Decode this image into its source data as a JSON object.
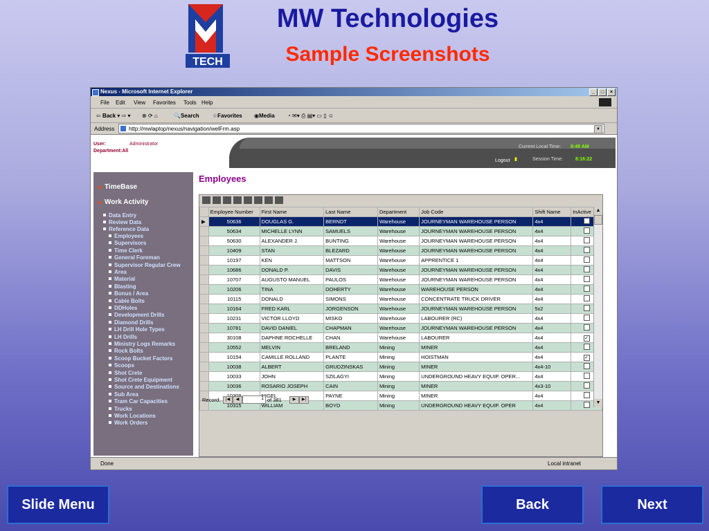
{
  "slide": {
    "logo_text": "TECH",
    "title": "MW Technologies",
    "subtitle": "Sample Screenshots",
    "buttons": {
      "menu": "Slide Menu",
      "back": "Back",
      "next": "Next"
    }
  },
  "browser": {
    "title": "Nexus - Microsoft Internet Explorer",
    "menu": [
      "File",
      "Edit",
      "View",
      "Favorites",
      "Tools",
      "Help"
    ],
    "toolbar": [
      "Back",
      "Search",
      "Favorites",
      "Media"
    ],
    "address_label": "Address",
    "address": "http://mwlaptop/nexus/navigation/welFrm.asp",
    "status": "Done",
    "zone": "Local intranet"
  },
  "app": {
    "user_label": "User:",
    "user": "Administrator",
    "department_label": "Department:All",
    "local_time_label": "Current Local Time:",
    "local_time": "9:49 AM",
    "logout": "Logout",
    "session_label": "Session Time:",
    "session_time": "8:16:22"
  },
  "sidebar": {
    "main": [
      "TimeBase",
      "Work Activity"
    ],
    "sub": [
      "Data Entry",
      "Review Data",
      "Reference Data"
    ],
    "ref_items": [
      "Employees",
      "Supervisors",
      "Time Clerk",
      "General Foreman",
      "Supervisor Regular Crew",
      "Area",
      "Material",
      "Blasting",
      "Bonus / Area",
      "Cable Bolts",
      "DDHoles",
      "Development Drills",
      "Diamond Drills",
      "LH Drill Hole Types",
      "LH Drills",
      "Ministry Logs Remarks",
      "Rock Bolts",
      "Scoop Bucket Factors",
      "Scoops",
      "Shot Crete",
      "Shot Crete Equipment",
      "Source and Destinations",
      "Sub Area",
      "Tram Car Capacities",
      "Trucks",
      "Work Locations",
      "Work Orders"
    ]
  },
  "employees": {
    "title": "Employees",
    "columns": [
      "Employee Number",
      "First Name",
      "Last Name",
      "Department",
      "Job Code",
      "Shift Name",
      "InActive"
    ],
    "rows": [
      [
        "50636",
        "DOUGLAS G.",
        "BERNDT",
        "Warehouse",
        "JOURNEYMAN WAREHOUSE PERSON",
        "4x4",
        false
      ],
      [
        "50634",
        "MICHELLE LYNN",
        "SAMUELS",
        "Warehouse",
        "JOURNEYMAN WAREHOUSE PERSON",
        "4x4",
        false
      ],
      [
        "50630",
        "ALEXANDER J.",
        "BUNTING",
        "Warehouse",
        "JOURNEYMAN WAREHOUSE PERSON",
        "4x4",
        false
      ],
      [
        "10409",
        "STAN",
        "BLEZARD",
        "Warehouse",
        "JOURNEYMAN WAREHOUSE PERSON",
        "4x4",
        false
      ],
      [
        "10197",
        "KEN",
        "MATTSON",
        "Warehouse",
        "APPRENTICE 1",
        "4x4",
        false
      ],
      [
        "10686",
        "DONALD P.",
        "DAVIS",
        "Warehouse",
        "JOURNEYMAN WAREHOUSE PERSON",
        "4x4",
        false
      ],
      [
        "10707",
        "AUGUSTO MANUEL",
        "PAULOS",
        "Warehouse",
        "JOURNEYMAN WAREHOUSE PERSON",
        "4x4",
        false
      ],
      [
        "10206",
        "TINA",
        "DOHERTY",
        "Warehouse",
        "WAREHOUSE PERSON",
        "4x4",
        false
      ],
      [
        "10115",
        "DONALD",
        "SIMONS",
        "Warehouse",
        "CONCENTRATE TRUCK DRIVER",
        "4x4",
        false
      ],
      [
        "10164",
        "FRED KARL",
        "JORGENSON",
        "Warehouse",
        "JOURNEYMAN WAREHOUSE PERSON",
        "5x2",
        false
      ],
      [
        "10231",
        "VICTOR LLOYD",
        "MISKO",
        "Warehouse",
        "LABOURER (RC)",
        "4x4",
        false
      ],
      [
        "10781",
        "DAVID DANIEL",
        "CHAPMAN",
        "Warehouse",
        "JOURNEYMAN WAREHOUSE PERSON",
        "4x4",
        false
      ],
      [
        "30108",
        "DAPHNE ROCHELLE",
        "CHAN",
        "Warehouse",
        "LABOURER",
        "4x4",
        true
      ],
      [
        "10552",
        "MELVIN",
        "BRELAND",
        "Mining",
        "MINER",
        "4x4",
        false
      ],
      [
        "10154",
        "CAMILLE ROLLAND",
        "PLANTE",
        "Mining",
        "HOISTMAN",
        "4x4",
        true
      ],
      [
        "10038",
        "ALBERT",
        "GRUDZINSKAS",
        "Mining",
        "MINER",
        "4x4-10",
        false
      ],
      [
        "10033",
        "JOHN",
        "SZILAGYI",
        "Mining",
        "UNDERGROUND HEAVY EQUIP. OPER...",
        "4x4",
        false
      ],
      [
        "10036",
        "ROSARIO JOSEPH",
        "CAIN",
        "Mining",
        "MINER",
        "4x3-10",
        false
      ],
      [
        "10309",
        "NIGEL",
        "PAYNE",
        "Mining",
        "MINER",
        "4x4",
        false
      ],
      [
        "10315",
        "WILLIAM",
        "BOYD",
        "Mining",
        "UNDERGROUND HEAVY EQUIP. OPER",
        "4x4",
        false
      ]
    ],
    "record_label": "Record:",
    "record_current": "1",
    "record_total": "of 381"
  }
}
